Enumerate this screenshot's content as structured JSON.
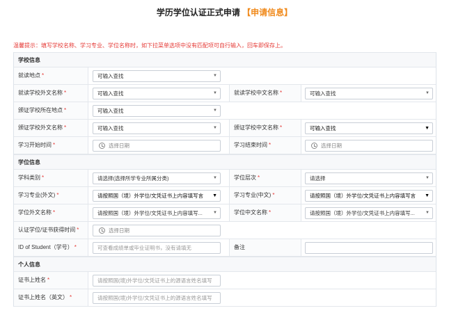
{
  "header": {
    "title": "学历学位认证正式申请",
    "title_highlight": "【申请信息】"
  },
  "notice": "温馨提示：填写学校名称、学习专业、学位名称时，如下拉菜单选项中没有匹配项可自行输入，回车即保存上。",
  "sections": {
    "school": "学校信息",
    "degree": "学位信息",
    "personal": "个人信息"
  },
  "fields": {
    "study_location": {
      "label": "就读地点",
      "value": "可输入查找"
    },
    "school_foreign": {
      "label": "就读学校外文名称",
      "value": "可输入查找"
    },
    "school_cn": {
      "label": "就读学校中文名称",
      "value": "可输入查找"
    },
    "issuer_location": {
      "label": "颁证学校所在地点",
      "value": "可输入查找"
    },
    "issuer_foreign": {
      "label": "颁证学校外文名称",
      "value": "可输入查找"
    },
    "issuer_cn": {
      "label": "颁证学校中文名称",
      "value": "可输入查找"
    },
    "start_time": {
      "label": "学习开始时间",
      "placeholder": "选择日期"
    },
    "end_time": {
      "label": "学习结束时间",
      "placeholder": "选择日期"
    },
    "category": {
      "label": "学科类别",
      "value": "请选择(选择所学专业所属分类)"
    },
    "level": {
      "label": "学位层次",
      "value": "请选择"
    },
    "major_foreign": {
      "label": "学习专业(外文)",
      "value": "请按照国（境）外学位/文凭证书上内容填写言"
    },
    "major_cn": {
      "label": "学习专业(中文)",
      "value": "请按照国（境）外学位/文凭证书上内容填写言"
    },
    "degree_foreign": {
      "label": "学位外文名称",
      "value": "请按照国（境）外学位/文凭证书上内容填写..."
    },
    "degree_cn": {
      "label": "学位中文名称",
      "value": "请按照国（境）外学位/文凭证书上内容填写..."
    },
    "award_time": {
      "label": "认证学位/证书获得时间",
      "placeholder": "选择日期"
    },
    "student_id": {
      "label": "ID of Student（学号）",
      "placeholder": "可查看成绩单或毕业证明书，没有请填无"
    },
    "remark": {
      "label": "备注",
      "value": ""
    },
    "cert_name": {
      "label": "证书上姓名",
      "placeholder": "请按照国(境)外学位/文凭证书上的源语言姓名填写"
    },
    "cert_name_en": {
      "label": "证书上姓名（英文）",
      "placeholder": "请按照国(境)外学位/文凭证书上的源语言姓名填写"
    }
  },
  "required_mark": "*",
  "icons": {
    "dropdown": "triangle-down-icon",
    "date": "clock-icon"
  }
}
